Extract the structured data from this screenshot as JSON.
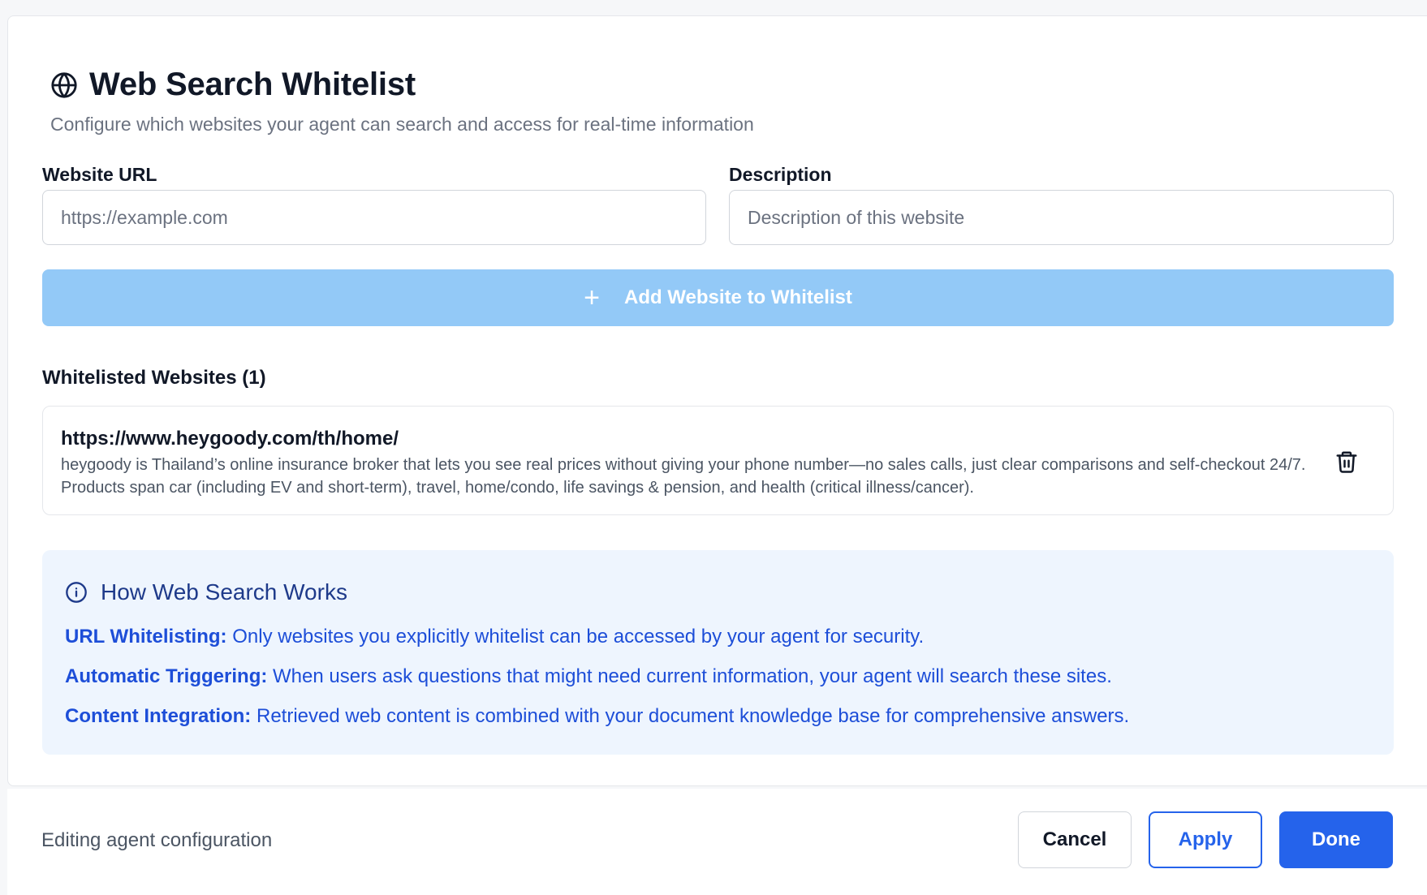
{
  "header": {
    "title": "Web Search Whitelist",
    "subtitle": "Configure which websites your agent can search and access for real-time information"
  },
  "form": {
    "url_label": "Website URL",
    "url_placeholder": "https://example.com",
    "url_value": "",
    "desc_label": "Description",
    "desc_placeholder": "Description of this website",
    "desc_value": "",
    "add_button_label": "Add Website to Whitelist"
  },
  "whitelist": {
    "heading": "Whitelisted Websites (1)",
    "items": [
      {
        "url": "https://www.heygoody.com/th/home/",
        "description": "heygoody is Thailand’s online insurance broker that lets you see real prices without giving your phone number—no sales calls, just clear comparisons and self-checkout 24/7. Products span car (including EV and short-term), travel, home/condo, life savings & pension, and health (critical illness/cancer)."
      }
    ]
  },
  "info": {
    "title": "How Web Search Works",
    "lines": [
      {
        "term": "URL Whitelisting:",
        "text": " Only websites you explicitly whitelist can be accessed by your agent for security."
      },
      {
        "term": "Automatic Triggering:",
        "text": " When users ask questions that might need current information, your agent will search these sites."
      },
      {
        "term": "Content Integration:",
        "text": " Retrieved web content is combined with your document knowledge base for comprehensive answers."
      }
    ]
  },
  "footer": {
    "status": "Editing agent configuration",
    "cancel_label": "Cancel",
    "apply_label": "Apply",
    "done_label": "Done"
  },
  "colors": {
    "primary": "#2563eb",
    "add_button_disabled": "#93c9f7",
    "info_bg": "#eef5fe",
    "info_text": "#1d4ed8"
  },
  "icons": {
    "title_icon": "globe-icon",
    "add_icon": "plus-icon",
    "delete_icon": "trash-icon",
    "info_icon": "info-icon"
  }
}
